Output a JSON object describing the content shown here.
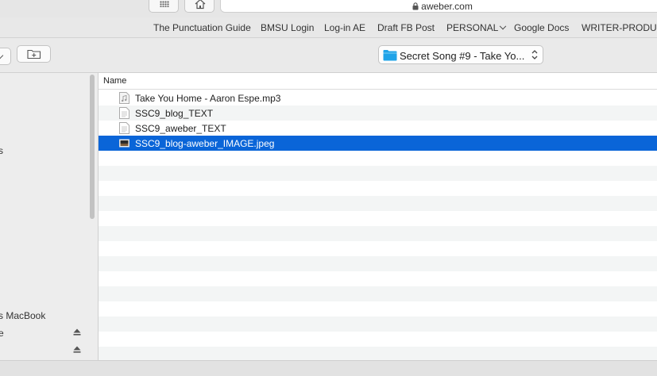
{
  "browser": {
    "address": "aweber.com",
    "favorites": [
      {
        "label": "The Punctuation Guide"
      },
      {
        "label": "BMSU Login"
      },
      {
        "label": "Log-in AE"
      },
      {
        "label": "Draft FB Post"
      },
      {
        "label": "PERSONAL"
      },
      {
        "label": "Google Docs"
      },
      {
        "label": "WRITER-PRODUC"
      }
    ]
  },
  "dialog": {
    "current_folder": "Secret Song #9 - Take Yo...",
    "column_header": "Name",
    "files": [
      {
        "name": "Take You Home - Aaron Espe.mp3",
        "icon": "audio-file-icon",
        "selected": false
      },
      {
        "name": "SSC9_blog_TEXT",
        "icon": "text-file-icon",
        "selected": false
      },
      {
        "name": "SSC9_aweber_TEXT",
        "icon": "text-file-icon",
        "selected": false
      },
      {
        "name": "SSC9_blog-aweber_IMAGE.jpeg",
        "icon": "image-file-icon",
        "selected": true
      }
    ],
    "sidebar": {
      "partial_s": "s",
      "device": "s MacBook",
      "partial_e": "e"
    }
  },
  "colors": {
    "selection": "#0a65d8",
    "folder": "#1fa3e8"
  }
}
